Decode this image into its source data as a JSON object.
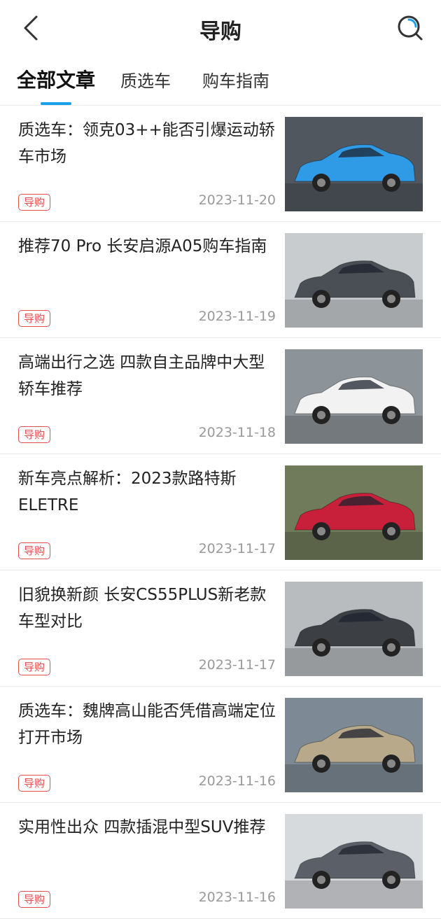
{
  "header": {
    "title": "导购",
    "back_icon": "chevron-left-icon",
    "search_icon": "search-icon"
  },
  "tabs": [
    {
      "label": "全部文章",
      "active": true
    },
    {
      "label": "质选车",
      "active": false
    },
    {
      "label": "购车指南",
      "active": false
    }
  ],
  "colors": {
    "accent": "#1aa0e8",
    "tag": "#e25050",
    "date": "#999999"
  },
  "articles": [
    {
      "title": "质选车：领克03++能否引爆运动轿车市场",
      "tag": "导购",
      "date": "2023-11-20",
      "car_color": "#2f9be6",
      "bg": "#50575f"
    },
    {
      "title": "推荐70 Pro 长安启源A05购车指南",
      "tag": "导购",
      "date": "2023-11-19",
      "car_color": "#4a4f56",
      "bg": "#c9cccf"
    },
    {
      "title": "高端出行之选 四款自主品牌中大型轿车推荐",
      "tag": "导购",
      "date": "2023-11-18",
      "car_color": "#f2f2f2",
      "bg": "#8d9499"
    },
    {
      "title": "新车亮点解析：2023款路特斯ELETRE",
      "tag": "导购",
      "date": "2023-11-17",
      "car_color": "#c8203a",
      "bg": "#6f7b5a"
    },
    {
      "title": "旧貌换新颜 长安CS55PLUS新老款车型对比",
      "tag": "导购",
      "date": "2023-11-17",
      "car_color": "#3c3f44",
      "bg": "#b9bcbf"
    },
    {
      "title": "质选车：魏牌高山能否凭借高端定位打开市场",
      "tag": "导购",
      "date": "2023-11-16",
      "car_color": "#b7a98a",
      "bg": "#7d8a95"
    },
    {
      "title": "实用性出众 四款插混中型SUV推荐",
      "tag": "导购",
      "date": "2023-11-16",
      "car_color": "#5b6068",
      "bg": "#d7dadd"
    }
  ]
}
